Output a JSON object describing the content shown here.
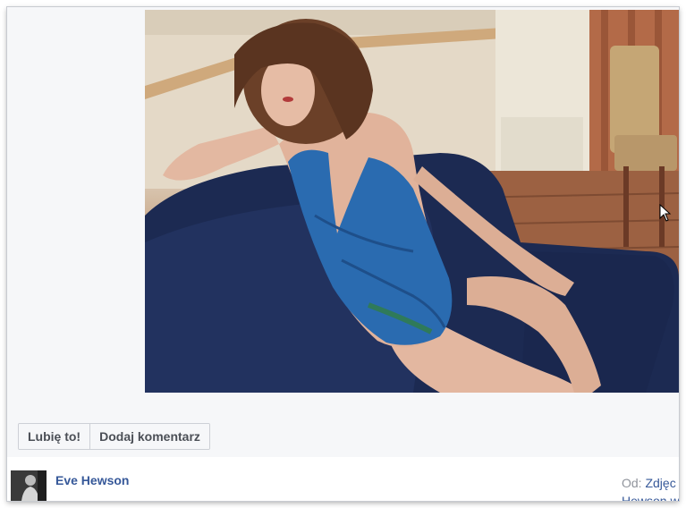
{
  "photo": {
    "subject": "woman in blue swimsuit reclining on navy sofa"
  },
  "actions": {
    "like_label": "Lubię to!",
    "comment_label": "Dodaj komentarz"
  },
  "author": {
    "name": "Eve Hewson"
  },
  "source": {
    "from_label": "Od:",
    "link_text": "Zdjęc",
    "link_line2": "Hewson w"
  },
  "colors": {
    "link": "#365899",
    "page_bg": "#f6f7f9",
    "button_border": "#cdd0d6"
  }
}
